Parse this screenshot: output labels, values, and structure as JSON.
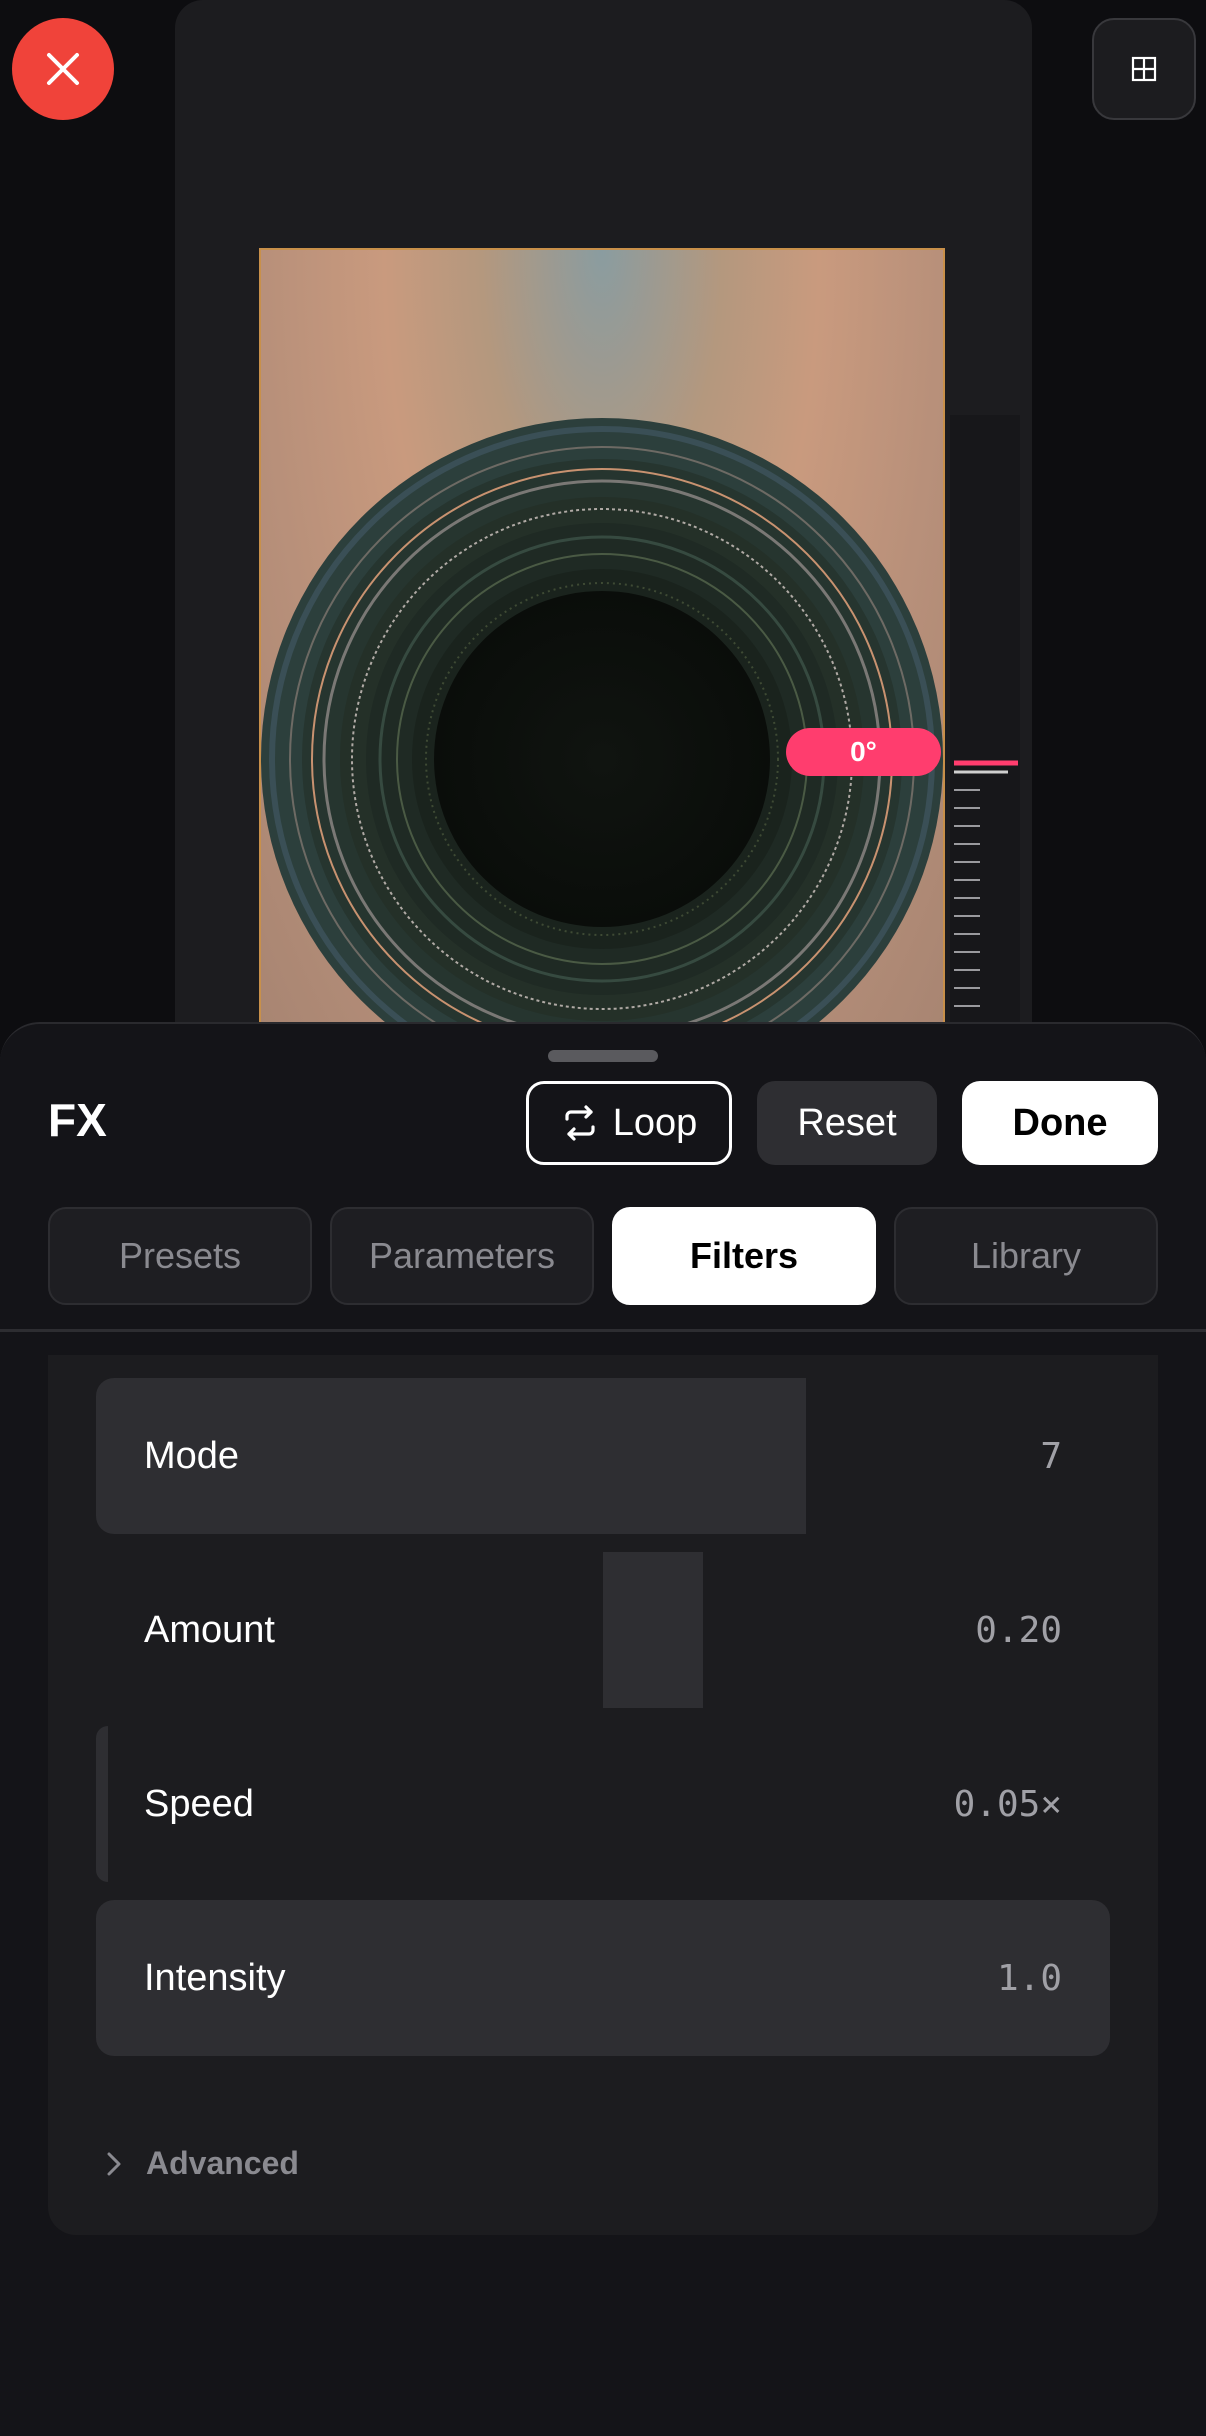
{
  "canvas": {
    "rotation_label": "0°"
  },
  "toolbar": {
    "close_icon": "close-icon",
    "grid_icon": "grid-icon"
  },
  "sheet": {
    "title": "FX",
    "loop_label": "Loop",
    "reset_label": "Reset",
    "done_label": "Done"
  },
  "tabs": [
    {
      "label": "Presets",
      "active": false
    },
    {
      "label": "Parameters",
      "active": false
    },
    {
      "label": "Filters",
      "active": true
    },
    {
      "label": "Library",
      "active": false
    }
  ],
  "params": [
    {
      "label": "Mode",
      "value": "7"
    },
    {
      "label": "Amount",
      "value": "0.20"
    },
    {
      "label": "Speed",
      "value": "0.05×"
    },
    {
      "label": "Intensity",
      "value": "1.0"
    }
  ],
  "advanced_label": "Advanced",
  "colors": {
    "accent_pink": "#ff3d6e",
    "close_red": "#f0433a",
    "frame_border": "#c8904a"
  }
}
